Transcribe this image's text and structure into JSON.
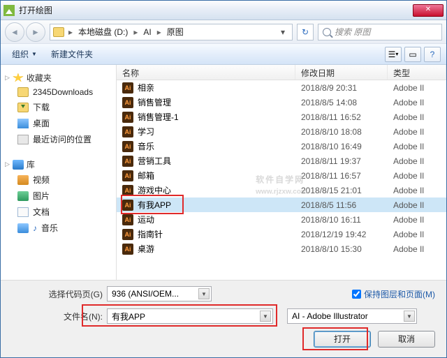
{
  "window": {
    "title": "打开绘图"
  },
  "breadcrumb": {
    "drive": "本地磁盘 (D:)",
    "p1": "AI",
    "p2": "原图"
  },
  "search": {
    "placeholder": "搜索 原图"
  },
  "toolbar": {
    "organize": "组织",
    "newfolder": "新建文件夹"
  },
  "sidebar": {
    "favorites": {
      "label": "收藏夹",
      "items": [
        "2345Downloads",
        "下载",
        "桌面",
        "最近访问的位置"
      ]
    },
    "library": {
      "label": "库",
      "items": [
        "视频",
        "图片",
        "文档",
        "音乐"
      ]
    }
  },
  "columns": {
    "name": "名称",
    "date": "修改日期",
    "type": "类型"
  },
  "files": [
    {
      "name": "相亲",
      "date": "2018/8/9 20:31",
      "type": "Adobe Il"
    },
    {
      "name": "销售管理",
      "date": "2018/8/5 14:08",
      "type": "Adobe Il"
    },
    {
      "name": "销售管理-1",
      "date": "2018/8/11 16:52",
      "type": "Adobe Il"
    },
    {
      "name": "学习",
      "date": "2018/8/10 18:08",
      "type": "Adobe Il"
    },
    {
      "name": "音乐",
      "date": "2018/8/10 16:49",
      "type": "Adobe Il"
    },
    {
      "name": "营销工具",
      "date": "2018/8/11 19:37",
      "type": "Adobe Il"
    },
    {
      "name": "邮箱",
      "date": "2018/8/11 16:57",
      "type": "Adobe Il"
    },
    {
      "name": "游戏中心",
      "date": "2018/8/15 21:01",
      "type": "Adobe Il"
    },
    {
      "name": "有我APP",
      "date": "2018/8/5 11:56",
      "type": "Adobe Il"
    },
    {
      "name": "运动",
      "date": "2018/8/10 16:11",
      "type": "Adobe Il"
    },
    {
      "name": "指南针",
      "date": "2018/12/19 19:42",
      "type": "Adobe Il"
    },
    {
      "name": "桌游",
      "date": "2018/8/10 15:30",
      "type": "Adobe Il"
    }
  ],
  "codepage": {
    "label": "选择代码页(G)",
    "value": "936  (ANSI/OEM..."
  },
  "preserve": {
    "label": "保持图层和页面(M)",
    "checked": true
  },
  "filename": {
    "label": "文件名(N):",
    "value": "有我APP"
  },
  "filter": {
    "value": "AI - Adobe Illustrator"
  },
  "buttons": {
    "open": "打开",
    "cancel": "取消"
  },
  "watermark": {
    "main": "软件自学网",
    "sub": "www.rjzxw.com"
  }
}
